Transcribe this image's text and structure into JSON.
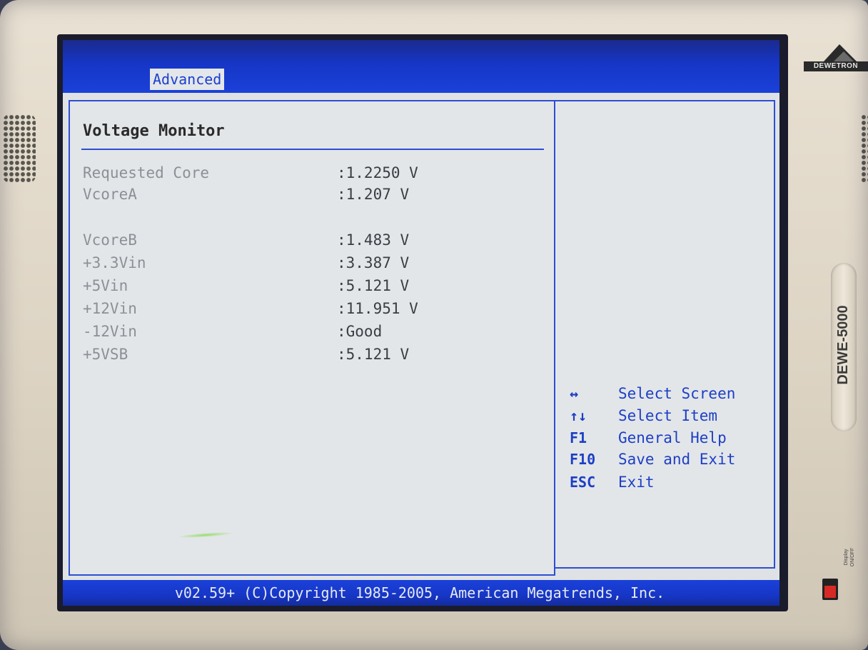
{
  "device": {
    "brand": "DEWETRON",
    "model": "DEWE-5000",
    "display_switch_label": "Display ON/OFF"
  },
  "bios": {
    "active_tab": "Advanced",
    "section_title": "Voltage Monitor",
    "readings": [
      {
        "label": "Requested Core",
        "value": ":1.2250 V"
      },
      {
        "label": "VcoreA",
        "value": ":1.207 V"
      },
      {
        "label": "VcoreB",
        "value": ":1.483 V"
      },
      {
        "label": "+3.3Vin",
        "value": ":3.387 V"
      },
      {
        "label": "+5Vin",
        "value": ":5.121 V"
      },
      {
        "label": "+12Vin",
        "value": ":11.951 V"
      },
      {
        "label": "-12Vin",
        "value": ":Good"
      },
      {
        "label": "+5VSB",
        "value": ":5.121 V"
      }
    ],
    "help": [
      {
        "key": "↔",
        "desc": "Select Screen"
      },
      {
        "key": "↑↓",
        "desc": "Select Item"
      },
      {
        "key": "F1",
        "desc": "General Help"
      },
      {
        "key": "F10",
        "desc": "Save and Exit"
      },
      {
        "key": "ESC",
        "desc": "Exit"
      }
    ],
    "footer": "v02.59+ (C)Copyright 1985-2005, American Megatrends, Inc."
  },
  "colors": {
    "bios_blue": "#1b41d9",
    "panel_bg": "#e3e6e9",
    "highlight_text": "#1d3fc4"
  }
}
